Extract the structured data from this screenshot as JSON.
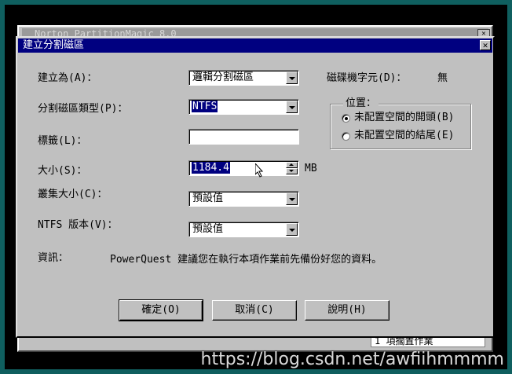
{
  "background_window": {
    "title": "Norton PartitionMagic 8.0",
    "footer_text": "1 項擱置作業"
  },
  "dialog": {
    "title": "建立分割磁區",
    "close_glyph": "✕",
    "create_as": {
      "label": "建立為(A)：",
      "value": "邏輯分割磁區"
    },
    "drive_letter": {
      "label": "磁碟機字元(D)：",
      "value": "無"
    },
    "partition_type": {
      "label": "分割磁區類型(P)：",
      "value": "NTFS"
    },
    "volume_label": {
      "label": "標籤(L)：",
      "value": ""
    },
    "size": {
      "label": "大小(S)：",
      "value": "1184.4",
      "unit": "MB"
    },
    "cluster_size": {
      "label": "叢集大小(C)：",
      "value": "預設值"
    },
    "ntfs_version": {
      "label": "NTFS 版本(V)：",
      "value": "預設值"
    },
    "position": {
      "title": "位置：",
      "options": [
        {
          "label": "未配置空間的開頭(B)",
          "selected": true
        },
        {
          "label": "未配置空間的結尾(E)",
          "selected": false
        }
      ]
    },
    "info": {
      "label": "資訊：",
      "text": "PowerQuest 建議您在執行本項作業前先備份好您的資料。"
    },
    "buttons": {
      "ok": "確定(O)",
      "cancel": "取消(C)",
      "help": "說明(H)"
    }
  },
  "watermark": "https://blog.csdn.net/awfiihmmmm",
  "colors": {
    "titlebar": "#000080",
    "face": "#c0c0c0",
    "desktop": "#008080"
  }
}
